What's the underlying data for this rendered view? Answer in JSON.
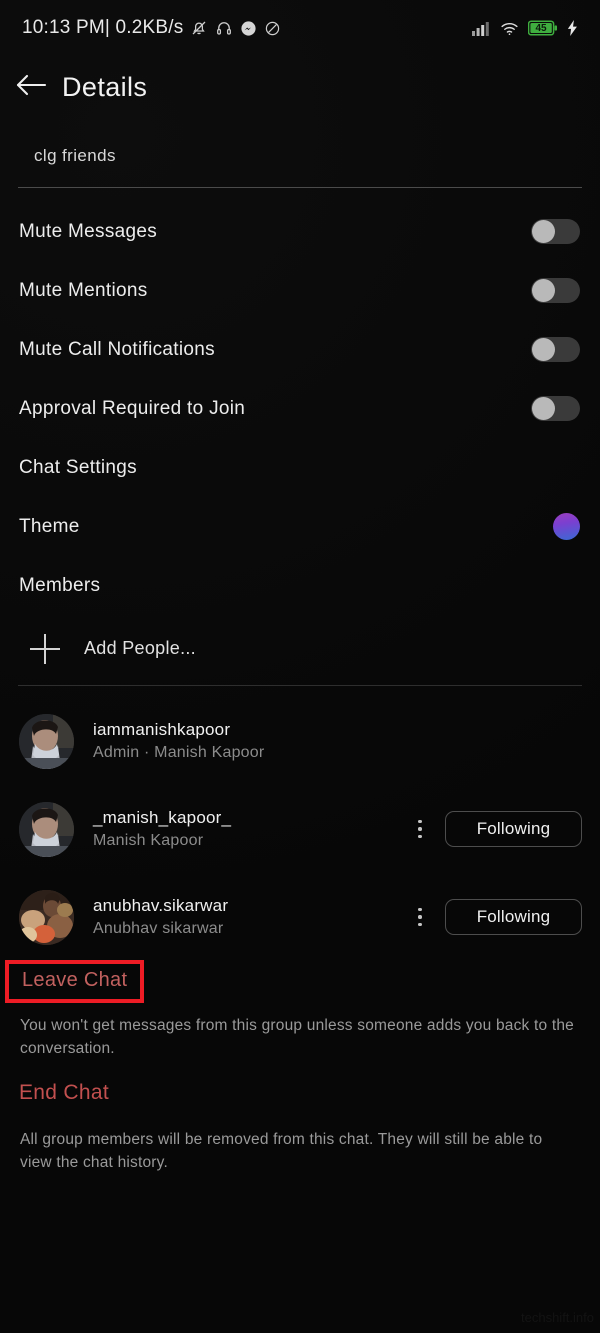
{
  "statusbar": {
    "clock": "10:13 PM| 0.2KB/s",
    "left_icons": [
      "bell-muted-icon",
      "headphones-icon",
      "messenger-icon",
      "do-not-disturb-icon"
    ],
    "right_icons": [
      "signal-icon",
      "wifi-icon",
      "battery-icon",
      "charging-bolt-icon"
    ],
    "battery_level": "45",
    "battery_color": "#3fae3f"
  },
  "header": {
    "back_icon": "back-arrow-icon",
    "title": "Details"
  },
  "group": {
    "name": "clg friends"
  },
  "settings": {
    "rows": [
      {
        "label": "Mute Messages",
        "control": "toggle",
        "value": "off"
      },
      {
        "label": "Mute Mentions",
        "control": "toggle",
        "value": "off"
      },
      {
        "label": "Mute Call Notifications",
        "control": "toggle",
        "value": "off"
      },
      {
        "label": "Approval Required to Join",
        "control": "toggle",
        "value": "off"
      },
      {
        "label": "Chat Settings",
        "control": "none",
        "value": ""
      },
      {
        "label": "Theme",
        "control": "swatch",
        "value": "purple-blue-gradient"
      },
      {
        "label": "Members",
        "control": "none",
        "value": ""
      }
    ],
    "theme_color_start": "#9b3fbd",
    "theme_color_end": "#3a6ad4"
  },
  "add_people": {
    "icon": "plus-icon",
    "label": "Add People..."
  },
  "members": [
    {
      "username": "iammanishkapoor",
      "subtitle": "Admin · Manish Kapoor",
      "has_menu": false,
      "action_label": ""
    },
    {
      "username": "_manish_kapoor_",
      "subtitle": "Manish Kapoor",
      "has_menu": true,
      "action_label": "Following"
    },
    {
      "username": "anubhav.sikarwar",
      "subtitle": "Anubhav sikarwar",
      "has_menu": true,
      "action_label": "Following"
    }
  ],
  "danger": {
    "leave_label": "Leave Chat",
    "leave_desc": "You won't get messages from this group unless someone adds you back to the conversation.",
    "end_label": "End Chat",
    "end_desc": "All group members will be removed from this chat. They will still be able to view the chat history.",
    "annotation_color": "#ee1c25",
    "leave_text_color": "#c2615f",
    "end_text_color": "#c2504f"
  },
  "watermark": {
    "text": "techshift.info"
  }
}
